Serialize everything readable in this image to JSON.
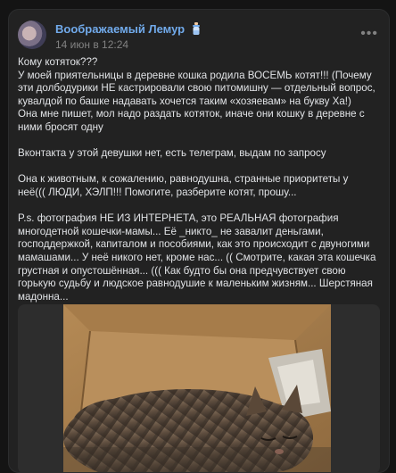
{
  "post": {
    "author": "Воображаемый Лемур",
    "date": "14 июн в 12:24",
    "more_label": "•••",
    "paragraphs": [
      "Кому котяток???",
      "У моей приятельницы в деревне кошка родила ВОСЕМЬ котят!!! (Почему эти долбодурики НЕ кастрировали свою питомишну — отдельный вопрос, кувалдой по башке надавать хочется таким «хозяевам» на букву Ха!)",
      "Она мне пишет, мол надо раздать котяток, иначе они кошку в деревне с ними бросят одну",
      "",
      "Вконтакта у этой девушки нет, есть телеграм, выдам по запросу",
      "",
      "Она к животным, к сожалению, равнодушна, странные приоритеты у неё((( ЛЮДИ, ХЭЛП!!! Помогите, разберите котят, прошу...",
      "",
      "P.s. фотография НЕ ИЗ ИНТЕРНЕТА, это РЕАЛЬНАЯ фотография многодетной кошечки-мамы... Её _никто_ не завалит деньгами, господдержкой, капиталом и пособиями, как это происходит с двуногими мамашами... У неё никого нет, кроме нас... (( Смотрите, какая эта кошечка грустная и опустошённая... ((( Как будто бы она предчувствует свою горькую судьбу и людское равнодушие к маленьким жизням... Шерстяная мадонна..."
    ]
  },
  "icons": {
    "badge": "baby-bottle-icon",
    "avatar": "user-avatar"
  },
  "colors": {
    "background": "#141414",
    "card": "#222222",
    "author_link": "#71aaeb",
    "secondary_text": "#828282",
    "body_text": "#e1e3e6"
  }
}
